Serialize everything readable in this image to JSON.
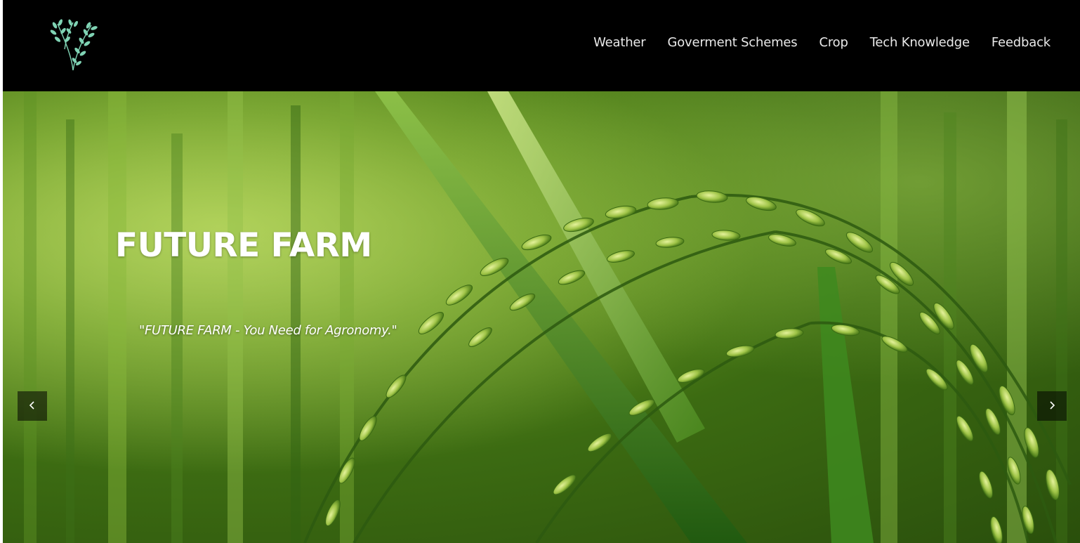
{
  "header": {
    "logo_icon": "rice-plant-logo-icon",
    "nav": [
      {
        "label": "Weather"
      },
      {
        "label": "Goverment Schemes"
      },
      {
        "label": "Crop"
      },
      {
        "label": "Tech Knowledge"
      },
      {
        "label": "Feedback"
      }
    ]
  },
  "hero": {
    "title": "FUTURE FARM",
    "tagline": "\"FUTURE FARM - You Need for Agronomy.\"",
    "background": "rice-crop-field-image",
    "prev_icon": "chevron-left-icon",
    "next_icon": "chevron-right-icon"
  },
  "colors": {
    "navbar_bg": "#000000",
    "nav_text": "#e9e9e9",
    "logo_leaf": "#7fd3b4",
    "hero_text": "#ffffff"
  }
}
